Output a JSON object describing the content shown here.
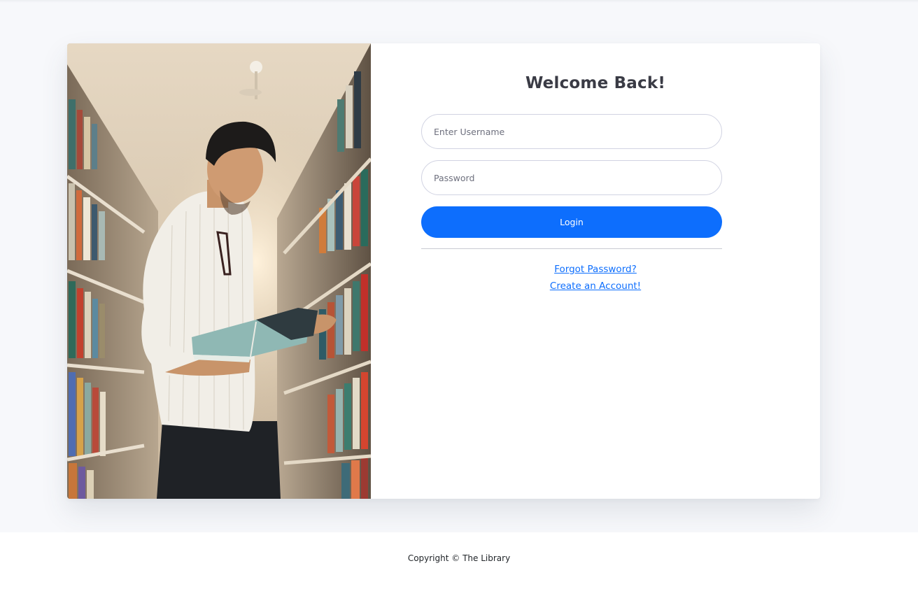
{
  "login": {
    "title": "Welcome Back!",
    "username_placeholder": "Enter Username",
    "username_value": "",
    "password_placeholder": "Password",
    "password_value": "",
    "login_label": "Login",
    "forgot_label": "Forgot Password?",
    "create_label": "Create an Account!"
  },
  "footer": {
    "copyright": "Copyright © The Library"
  },
  "theme": {
    "accent": "#0d6efd",
    "page_background": "#f7f8fb",
    "heading_color": "#3a3b45"
  }
}
